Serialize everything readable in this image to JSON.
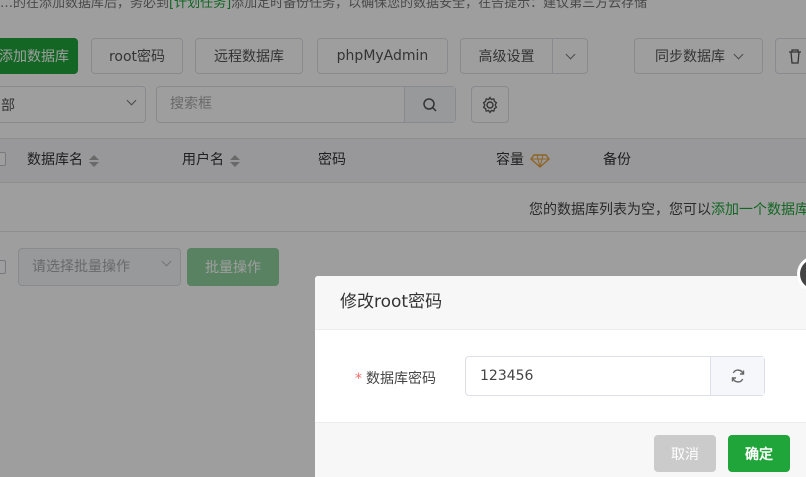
{
  "notice": {
    "text_pre": "…的在添加数据库后，务必到",
    "text_link": "[计划任务]",
    "text_post": "添加定时备份任务，以确保您的数据安全，在告提示：建议第三方云存储"
  },
  "toolbar": {
    "add_db": "添加数据库",
    "root_pw": "root密码",
    "remote_db": "远程数据库",
    "phpmyadmin": "phpMyAdmin",
    "advanced": "高级设置",
    "sync_db": "同步数据库"
  },
  "filter": {
    "group_value": "部",
    "search_placeholder": "搜索框"
  },
  "table": {
    "headers": [
      "数据库名",
      "用户名",
      "密码",
      "容量",
      "备份"
    ],
    "empty_text": "您的数据库列表为空，您可以",
    "empty_link": "添加一个数据库"
  },
  "batch": {
    "select_placeholder": "请选择批量操作",
    "button": "批量操作"
  },
  "dialog": {
    "title": "修改root密码",
    "required_mark": "*",
    "field_label": "数据库密码",
    "password_value": "123456",
    "cancel": "取消",
    "confirm": "确定"
  },
  "colors": {
    "primary": "#20a53a",
    "overlay": "rgba(0,0,0,0.38)"
  },
  "icons": [
    "chevron-down-icon",
    "search-icon",
    "gear-icon",
    "sort-icon",
    "diamond-icon",
    "refresh-icon",
    "close-icon"
  ]
}
